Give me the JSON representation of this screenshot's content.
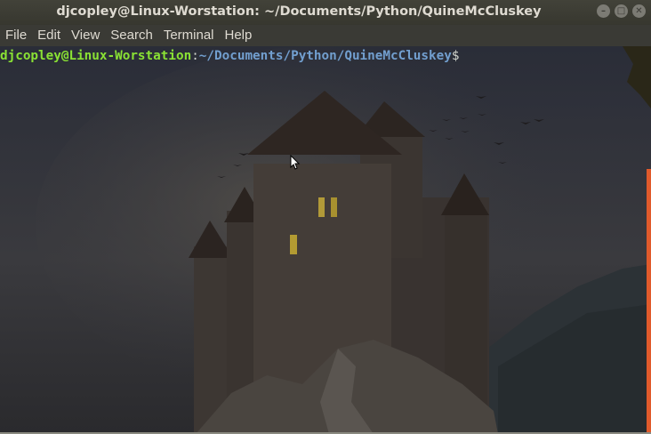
{
  "window": {
    "title": "djcopley@Linux-Worstation: ~/Documents/Python/QuineMcCluskey",
    "buttons": [
      {
        "name": "minimize",
        "glyph": "–"
      },
      {
        "name": "maximize",
        "glyph": "□"
      },
      {
        "name": "close",
        "glyph": "✕"
      }
    ]
  },
  "menubar": {
    "items": [
      "File",
      "Edit",
      "View",
      "Search",
      "Terminal",
      "Help"
    ]
  },
  "terminal": {
    "prompt": {
      "user_host": "djcopley@Linux-Worstation",
      "separator": ":",
      "path": "~/Documents/Python/QuineMcCluskey",
      "symbol": "$"
    },
    "colors": {
      "user_host": "#8ae234",
      "path": "#729fcf",
      "scrollbar": "#e05a2b"
    }
  }
}
